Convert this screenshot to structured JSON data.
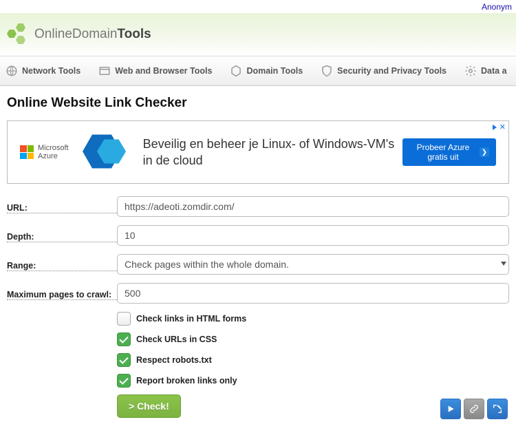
{
  "top_link": "Anonym",
  "brand": {
    "part1": "Online",
    "part2": "Domain",
    "part3": "Tools"
  },
  "nav": {
    "items": [
      {
        "label": "Network Tools"
      },
      {
        "label": "Web and Browser Tools"
      },
      {
        "label": "Domain Tools"
      },
      {
        "label": "Security and Privacy Tools"
      },
      {
        "label": "Data a"
      }
    ]
  },
  "page_title": "Online Website Link Checker",
  "ad": {
    "brand": "Microsoft\nAzure",
    "copy": "Beveilig en beheer je Linux- of Windows-VM's in de cloud",
    "cta": "Probeer Azure gratis uit",
    "close_glyph": "✕"
  },
  "form": {
    "url_label": "URL:",
    "url_value": "https://adeoti.zomdir.com/",
    "depth_label": "Depth:",
    "depth_value": "10",
    "range_label": "Range:",
    "range_value": "Check pages within the whole domain.",
    "max_label": "Maximum pages to crawl:",
    "max_value": "500",
    "chk1": "Check links in HTML forms",
    "chk2": "Check URLs in CSS",
    "chk3": "Respect robots.txt",
    "chk4": "Report broken links only",
    "submit": "> Check!"
  }
}
